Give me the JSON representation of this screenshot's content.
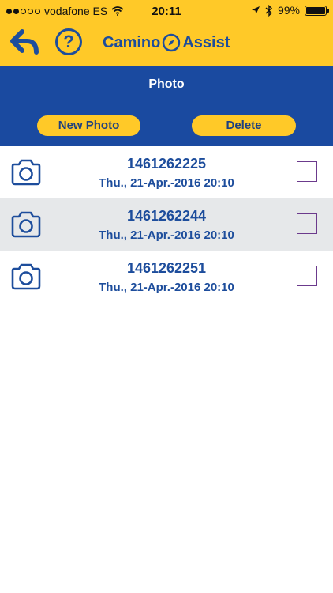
{
  "status_bar": {
    "carrier": "vodafone ES",
    "time": "20:11",
    "battery": "99%",
    "battery_level": 0.99
  },
  "header": {
    "logo_left": "Camino",
    "logo_right": "Assist",
    "help_label": "?"
  },
  "band": {
    "title": "Photo",
    "new_label": "New Photo",
    "delete_label": "Delete"
  },
  "photos": [
    {
      "id": "1461262225",
      "date": "Thu., 21-Apr.-2016  20:10"
    },
    {
      "id": "1461262244",
      "date": "Thu., 21-Apr.-2016  20:10"
    },
    {
      "id": "1461262251",
      "date": "Thu., 21-Apr.-2016  20:10"
    }
  ],
  "colors": {
    "accent_yellow": "#ffc928",
    "brand_blue": "#1a4aa0",
    "text_blue": "#1d4d9c",
    "checkbox_purple": "#6b3a8c"
  }
}
